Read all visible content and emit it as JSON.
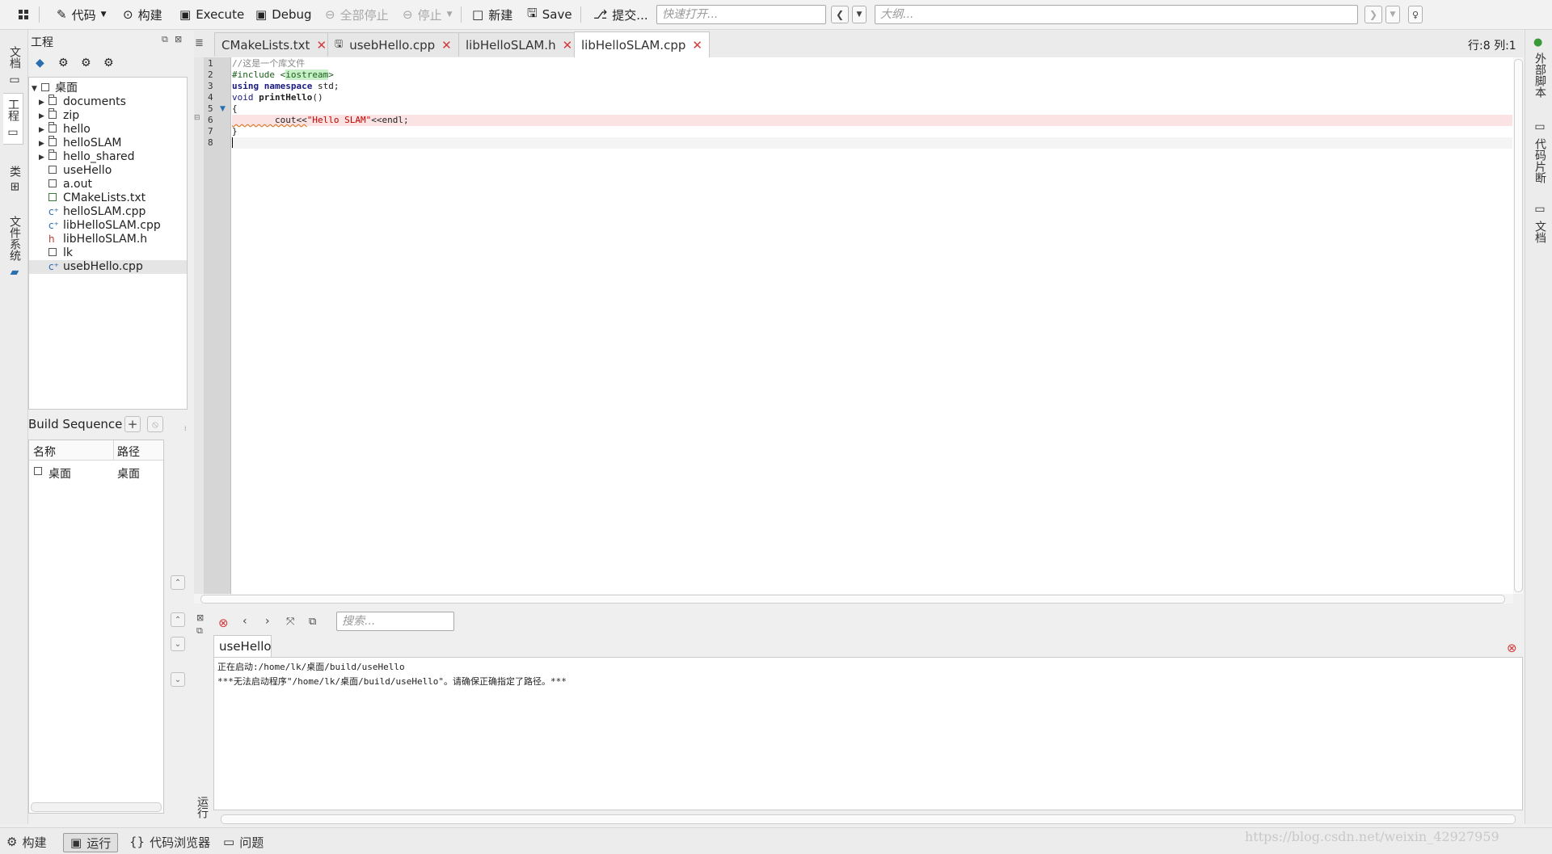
{
  "toolbar": {
    "code": "代码",
    "build": "构建",
    "execute": "Execute",
    "debug": "Debug",
    "stop_all": "全部停止",
    "stop": "停止",
    "new": "新建",
    "save": "Save",
    "commit": "提交...",
    "quick_open_placeholder": "快速打开...",
    "outline_placeholder": "大纲..."
  },
  "left_tabs": [
    "文档",
    "工程",
    "类",
    "文件系统"
  ],
  "project": {
    "title": "工程",
    "root": "桌面",
    "items": [
      {
        "label": "documents",
        "kind": "folder"
      },
      {
        "label": "zip",
        "kind": "folder"
      },
      {
        "label": "hello",
        "kind": "folder"
      },
      {
        "label": "helloSLAM",
        "kind": "folder"
      },
      {
        "label": "hello_shared",
        "kind": "folder"
      },
      {
        "label": "useHello",
        "kind": "exe"
      },
      {
        "label": "a.out",
        "kind": "exe"
      },
      {
        "label": "CMakeLists.txt",
        "kind": "txt"
      },
      {
        "label": "helloSLAM.cpp",
        "kind": "cpp"
      },
      {
        "label": "libHelloSLAM.cpp",
        "kind": "cpp"
      },
      {
        "label": "libHelloSLAM.h",
        "kind": "h"
      },
      {
        "label": "lk",
        "kind": "exe"
      },
      {
        "label": "usebHello.cpp",
        "kind": "cpp"
      }
    ]
  },
  "build_sequence": {
    "title": "Build Sequence",
    "col_name": "名称",
    "col_path": "路径",
    "row_name": "桌面",
    "row_path": "桌面"
  },
  "editor": {
    "tabs": [
      "CMakeLists.txt",
      "usebHello.cpp",
      "libHelloSLAM.h",
      "libHelloSLAM.cpp"
    ],
    "active_tab": "libHelloSLAM.cpp",
    "cursor_pos": "行:8 列:1",
    "line_numbers": [
      "1",
      "2",
      "3",
      "4",
      "5",
      "6",
      "7",
      "8"
    ],
    "code": {
      "l1": "//这是一个库文件",
      "l2_pre": "#include <",
      "l2_hl": "iostream",
      "l2_post": ">",
      "l3_kw": "using namespace",
      "l3_rest": " std;",
      "l4_kw": "void",
      "l4_fn": " printHello",
      "l4_rest": "()",
      "l5": "{",
      "l6_a": "        cout<<",
      "l6_str": "\"Hello SLAM\"",
      "l6_b": "<<endl;",
      "l7": "}",
      "l8": ""
    }
  },
  "output": {
    "search_placeholder": "搜索...",
    "tab_label": "useHello",
    "lines": [
      "正在启动:/home/lk/桌面/build/useHello",
      "***无法启动程序\"/home/lk/桌面/build/useHello\"。请确保正确指定了路径。***"
    ],
    "side_label": "运行"
  },
  "right_tabs": [
    "外部脚本",
    "代码片断",
    "文档"
  ],
  "statusbar": {
    "build": "构建",
    "run": "运行",
    "code_browser": "代码浏览器",
    "problems": "问题"
  },
  "watermark": "https://blog.csdn.net/weixin_42927959"
}
